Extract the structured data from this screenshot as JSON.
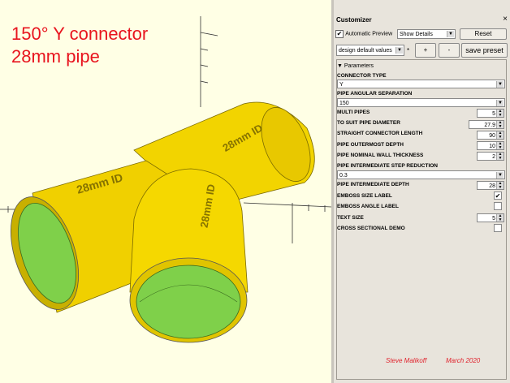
{
  "viewport": {
    "title_line1": "150° Y connector",
    "title_line2": "28mm pipe",
    "emboss_text_left": "28mm ID",
    "emboss_text_right": "28mm ID",
    "emboss_text_front": "28mm ID"
  },
  "customizer": {
    "title": "Customizer",
    "close_glyph": "×",
    "automatic_preview_label": "Automatic Preview",
    "automatic_preview_checked": true,
    "details_select": "Show Details",
    "reset_label": "Reset",
    "preset_select": "design default values",
    "preset_marker": "*",
    "add_label": "+",
    "remove_label": "-",
    "save_preset_label": "save preset",
    "parameters_group": "Parameters",
    "params": [
      {
        "label": "CONNECTOR TYPE",
        "value": "Y",
        "kind": "select"
      },
      {
        "label": "PIPE ANGULAR SEPARATION",
        "value": "150",
        "kind": "select"
      },
      {
        "label": "MULTI PIPES",
        "value": "5",
        "kind": "spin"
      },
      {
        "label": "TO SUIT PIPE DIAMETER",
        "value": "27.9",
        "kind": "spin"
      },
      {
        "label": "STRAIGHT CONNECTOR LENGTH",
        "value": "90",
        "kind": "spin"
      },
      {
        "label": "PIPE OUTERMOST DEPTH",
        "value": "10",
        "kind": "spin"
      },
      {
        "label": "PIPE NOMINAL WALL THICKNESS",
        "value": "2",
        "kind": "spin"
      },
      {
        "label": "PIPE INTERMEDIATE STEP REDUCTION",
        "value": "0.3",
        "kind": "select"
      },
      {
        "label": "PIPE INTERMEDIATE DEPTH",
        "value": "28",
        "kind": "spin"
      },
      {
        "label": "EMBOSS SIZE LABEL",
        "value": "✔",
        "kind": "check"
      },
      {
        "label": "EMBOSS ANGLE LABEL",
        "value": "",
        "kind": "check"
      },
      {
        "label": "TEXT SIZE",
        "value": "5",
        "kind": "spin"
      },
      {
        "label": "CROSS SECTIONAL DEMO",
        "value": "",
        "kind": "check"
      }
    ],
    "credit_name": "Steve Malikoff",
    "credit_date": "March 2020"
  }
}
